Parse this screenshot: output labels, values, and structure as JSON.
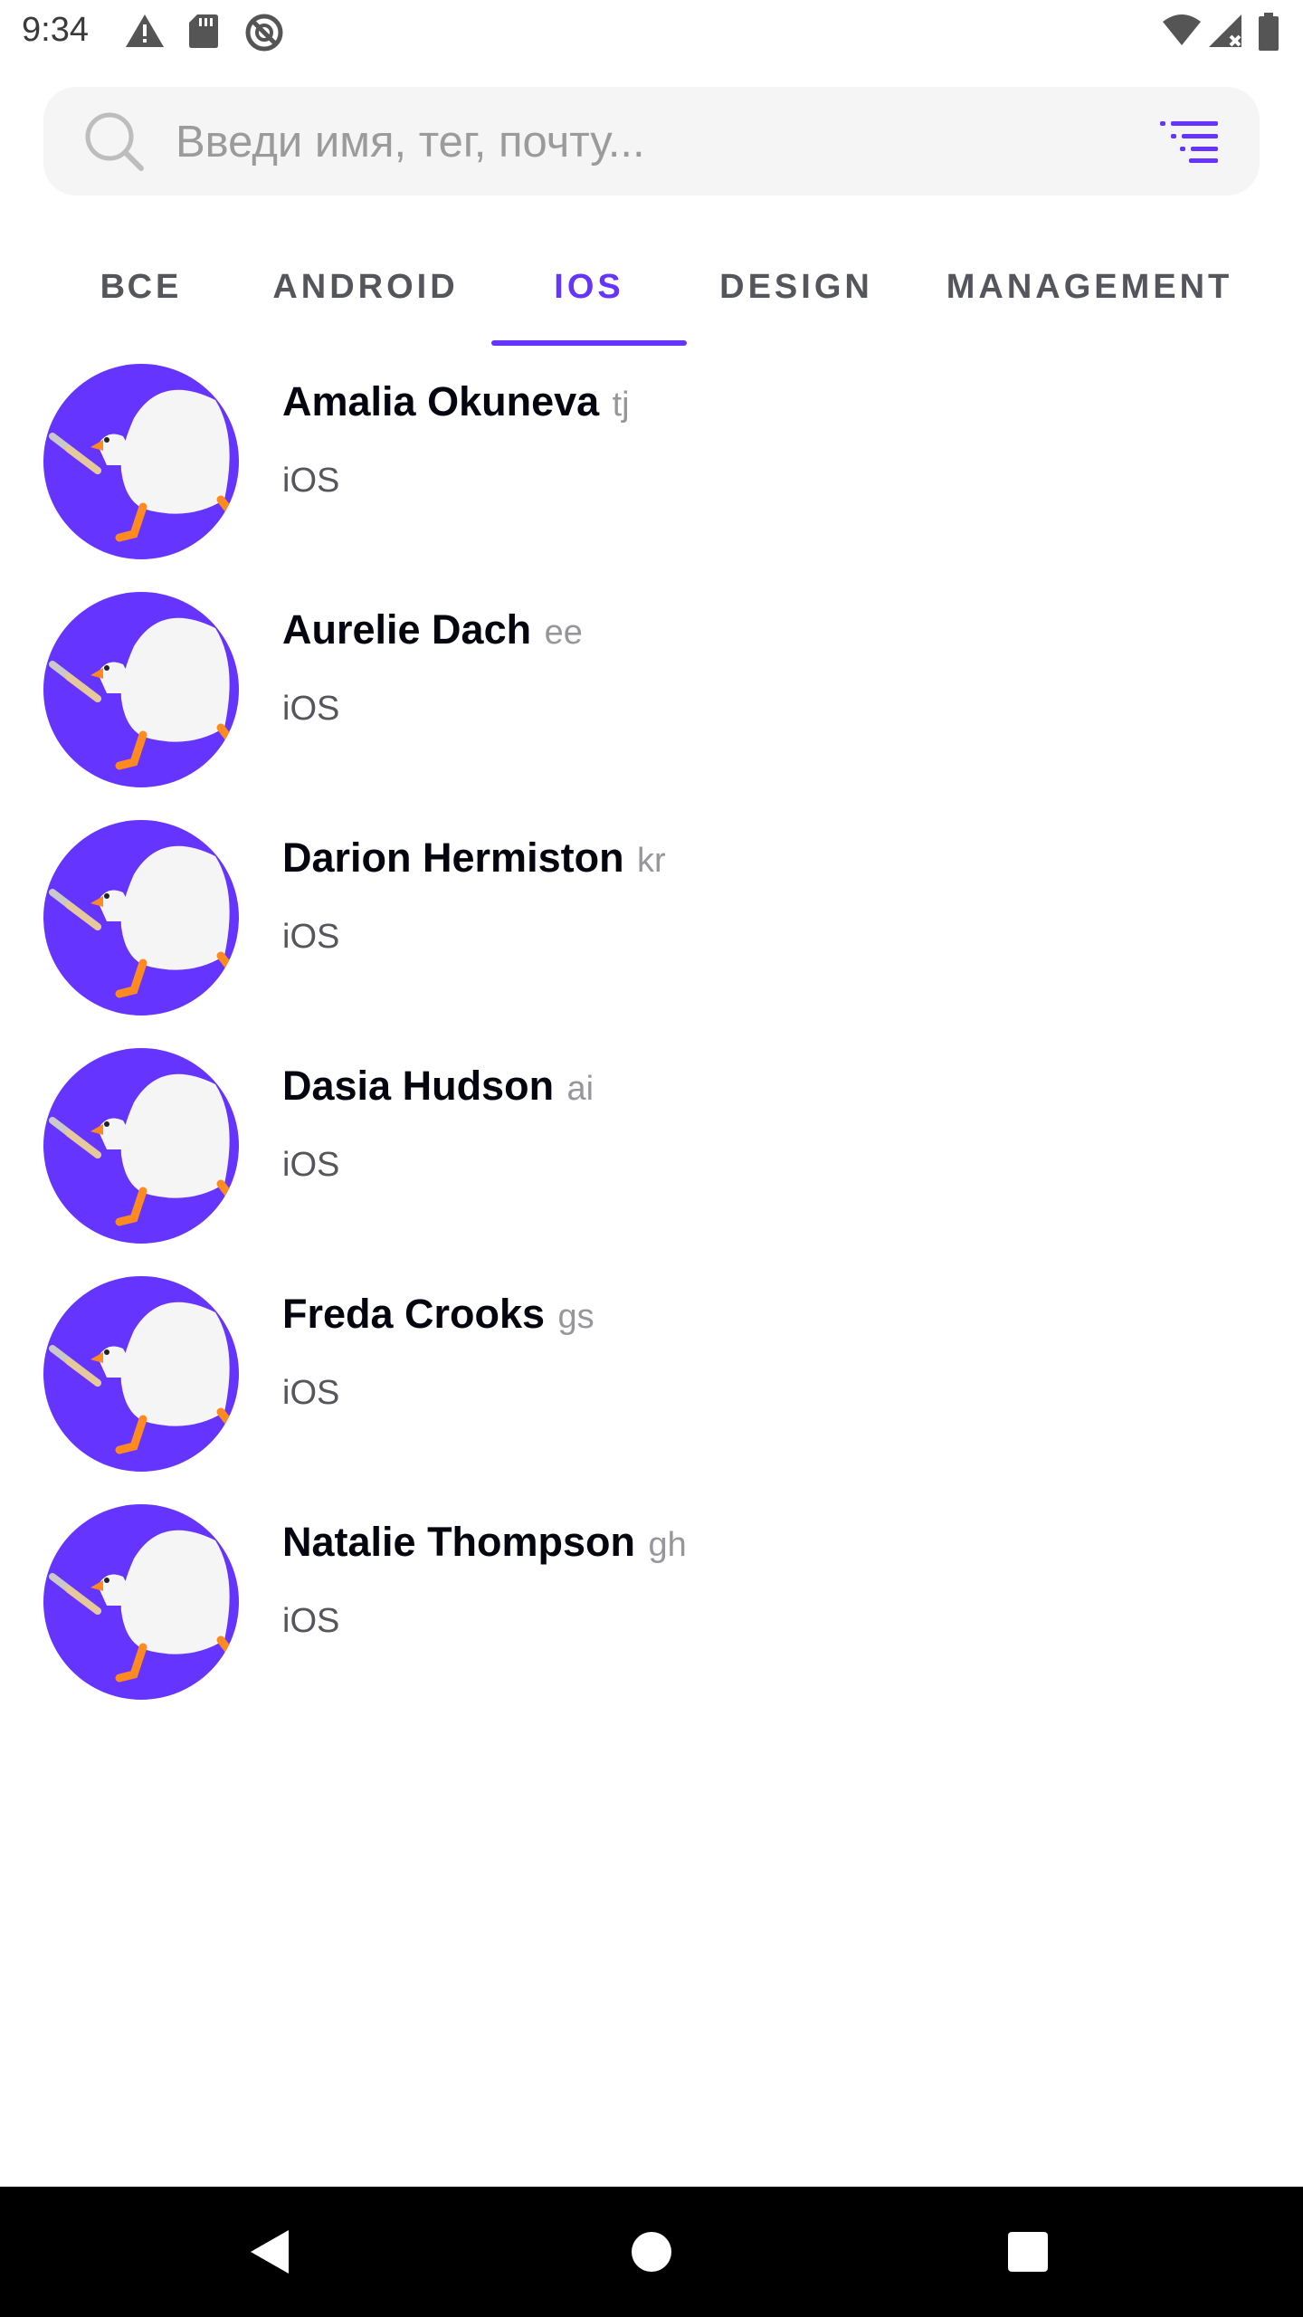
{
  "status_bar": {
    "time": "9:34",
    "icons": [
      "warning-icon",
      "sd-card-icon",
      "sync-icon",
      "wifi-icon",
      "cell-signal-icon",
      "battery-icon"
    ]
  },
  "search": {
    "placeholder": "Введи имя, тег, почту...",
    "value": ""
  },
  "tabs": [
    {
      "label": "ВСЕ",
      "active": false
    },
    {
      "label": "ANDROID",
      "active": false
    },
    {
      "label": "IOS",
      "active": true
    },
    {
      "label": "DESIGN",
      "active": false
    },
    {
      "label": "MANAGEMENT",
      "active": false
    }
  ],
  "users": [
    {
      "name": "Amalia Okuneva",
      "tag": "tj",
      "department": "iOS"
    },
    {
      "name": "Aurelie Dach",
      "tag": "ee",
      "department": "iOS"
    },
    {
      "name": "Darion Hermiston",
      "tag": "kr",
      "department": "iOS"
    },
    {
      "name": "Dasia Hudson",
      "tag": "ai",
      "department": "iOS"
    },
    {
      "name": "Freda Crooks",
      "tag": "gs",
      "department": "iOS"
    },
    {
      "name": "Natalie Thompson",
      "tag": "gh",
      "department": "iOS"
    }
  ],
  "colors": {
    "accent": "#6534ff",
    "avatar_bg": "#6534ff",
    "text_primary": "#050510",
    "text_secondary": "#55555c",
    "tag": "#97979b"
  },
  "nav_bar": {
    "icons": [
      "back-icon",
      "home-icon",
      "recents-icon"
    ]
  }
}
